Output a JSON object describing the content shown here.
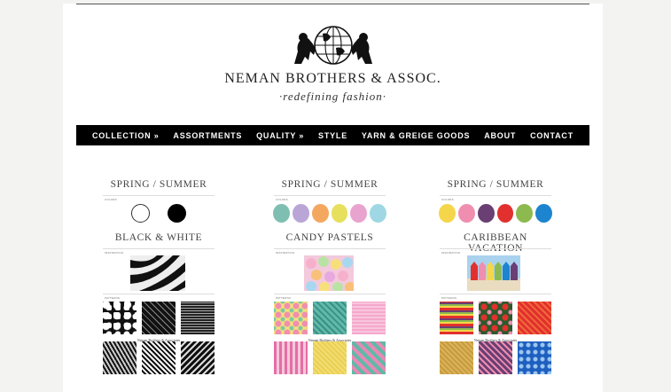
{
  "brand": {
    "name": "NEMAN BROTHERS & ASSOC.",
    "tagline": "·redefining fashion·",
    "logo_icon": "globe-with-lions-icon"
  },
  "nav": {
    "items": [
      {
        "label": "COLLECTION »"
      },
      {
        "label": "ASSORTMENTS"
      },
      {
        "label": "QUALITY »"
      },
      {
        "label": "STYLE"
      },
      {
        "label": "YARN & GREIGE GOODS"
      },
      {
        "label": "ABOUT"
      },
      {
        "label": "CONTACT"
      }
    ]
  },
  "boards": [
    {
      "season": "SPRING / SUMMER",
      "colors_label": "COLORS",
      "colors": [
        "#ffffff",
        "#000000"
      ],
      "name": "BLACK & WHITE",
      "inspiration_label": "INSPIRATION",
      "patterns_label": "PATTERNS",
      "caption": "Neman Brothers & Associates"
    },
    {
      "season": "SPRING / SUMMER",
      "colors_label": "COLORS",
      "colors": [
        "#7fbfb2",
        "#b9a6d6",
        "#f4a85f",
        "#e6e05e",
        "#e8a4cf",
        "#9fd8e4"
      ],
      "name": "CANDY PASTELS",
      "inspiration_label": "INSPIRATION",
      "patterns_label": "PATTERNS",
      "caption": "Neman Brothers & Associates"
    },
    {
      "season": "SPRING / SUMMER",
      "colors_label": "COLORS",
      "colors": [
        "#f5d64a",
        "#f08eb0",
        "#6a3f74",
        "#e2302e",
        "#8dba4f",
        "#1d84cf"
      ],
      "name": "CARIBBEAN VACATION",
      "inspiration_label": "INSPIRATION",
      "patterns_label": "PATTERNS",
      "caption": "Neman Brothers & Associates"
    }
  ]
}
